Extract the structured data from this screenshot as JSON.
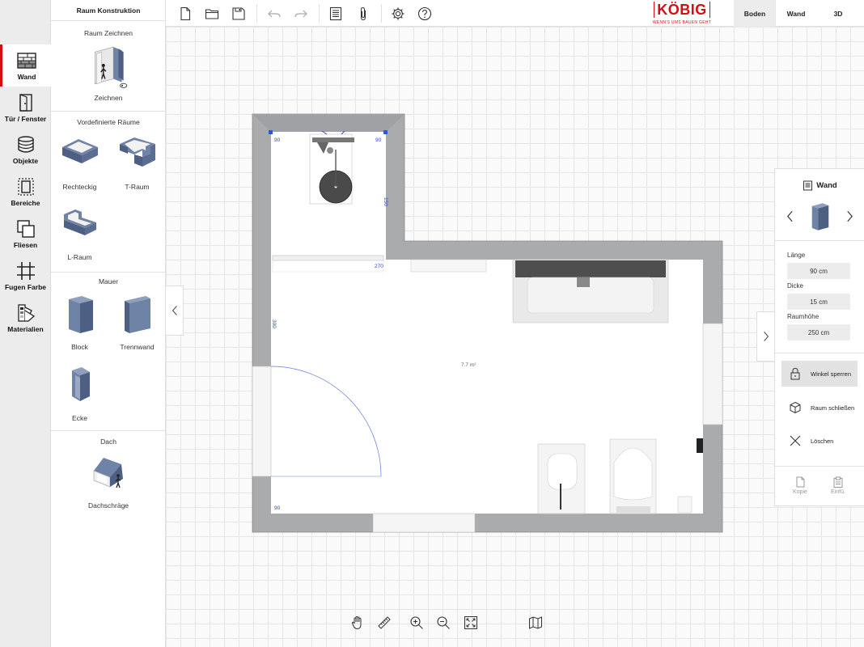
{
  "left_rail": {
    "items": [
      {
        "label": "Wand",
        "icon": "wall-pattern-icon",
        "active": true
      },
      {
        "label": "Tür / Fenster",
        "icon": "door-icon",
        "active": false
      },
      {
        "label": "Objekte",
        "icon": "objects-stack-icon",
        "active": false
      },
      {
        "label": "Bereiche",
        "icon": "area-icon",
        "active": false
      },
      {
        "label": "Fliesen",
        "icon": "tiles-icon",
        "active": false
      },
      {
        "label": "Fugen Farbe",
        "icon": "grout-grid-icon",
        "active": false
      },
      {
        "label": "Materialien",
        "icon": "materials-swatch-icon",
        "active": false
      }
    ]
  },
  "construction_panel": {
    "title": "Raum Konstruktion",
    "sections": {
      "draw": {
        "title": "Raum Zeichnen",
        "items": [
          {
            "label": "Zeichnen"
          }
        ]
      },
      "predefined": {
        "title": "Vordefinierte Räume",
        "items": [
          {
            "label": "Rechteckig"
          },
          {
            "label": "T-Raum"
          },
          {
            "label": "L-Raum"
          }
        ]
      },
      "mauer": {
        "title": "Mauer",
        "items": [
          {
            "label": "Block"
          },
          {
            "label": "Trennwand"
          },
          {
            "label": "Ecke"
          }
        ]
      },
      "dach": {
        "title": "Dach",
        "items": [
          {
            "label": "Dachschräge"
          }
        ]
      }
    }
  },
  "toolbar": {
    "buttons": [
      "new-file-icon",
      "open-folder-icon",
      "save-icon",
      "undo-icon",
      "redo-icon",
      "document-list-icon",
      "attachment-icon",
      "settings-gear-icon",
      "help-icon"
    ]
  },
  "logo": {
    "name": "KÖBIG",
    "tagline": "WENN'S UMS BAUEN GEHT",
    "color": "#d40f14"
  },
  "view_tabs": [
    {
      "label": "Boden",
      "active": true
    },
    {
      "label": "Wand",
      "active": false
    },
    {
      "label": "3D",
      "active": false
    }
  ],
  "plan": {
    "area": "7.7 m²",
    "dimensions": {
      "top_left_angle": "90",
      "top_right_angle": "90",
      "right_wall": "150",
      "bottom_wall": "270",
      "left_wall": "300",
      "bottom_left_angle": "90"
    }
  },
  "properties": {
    "title": "Wand",
    "fields": [
      {
        "label": "Länge",
        "value": "90 cm"
      },
      {
        "label": "Dicke",
        "value": "15 cm"
      },
      {
        "label": "Raumhöhe",
        "value": "250 cm"
      }
    ],
    "actions": [
      {
        "label": "Winkel sperren",
        "icon": "lock-icon",
        "active": true
      },
      {
        "label": "Raum schließen",
        "icon": "cube-close-icon",
        "active": false
      },
      {
        "label": "Löschen",
        "icon": "close-x-icon",
        "active": false
      }
    ],
    "bottom_actions": [
      {
        "label": "Kopie",
        "icon": "copy-icon"
      },
      {
        "label": "Einfü.",
        "icon": "paste-icon"
      }
    ]
  },
  "bottom_tools": [
    "pan-hand-icon",
    "ruler-icon",
    "zoom-in-icon",
    "zoom-out-icon",
    "fit-screen-icon",
    "map-icon"
  ],
  "colors": {
    "accent": "#d40f14",
    "wall": "#a9abad",
    "dimension": "#3344cc"
  }
}
